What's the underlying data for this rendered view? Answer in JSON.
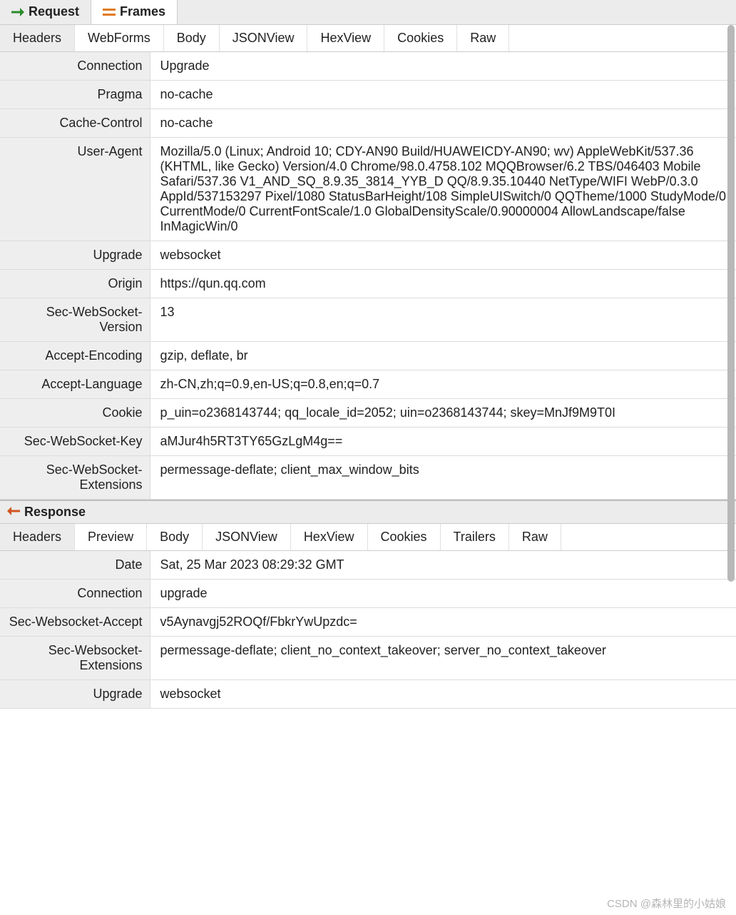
{
  "topTabs": {
    "request": "Request",
    "frames": "Frames"
  },
  "requestSubTabs": [
    "Headers",
    "WebForms",
    "Body",
    "JSONView",
    "HexView",
    "Cookies",
    "Raw"
  ],
  "requestHeaders": [
    {
      "key": "Connection",
      "value": "Upgrade"
    },
    {
      "key": "Pragma",
      "value": "no-cache"
    },
    {
      "key": "Cache-Control",
      "value": "no-cache"
    },
    {
      "key": "User-Agent",
      "value": "Mozilla/5.0 (Linux; Android 10; CDY-AN90 Build/HUAWEICDY-AN90; wv) AppleWebKit/537.36 (KHTML, like Gecko) Version/4.0 Chrome/98.0.4758.102 MQQBrowser/6.2 TBS/046403 Mobile Safari/537.36 V1_AND_SQ_8.9.35_3814_YYB_D QQ/8.9.35.10440 NetType/WIFI WebP/0.3.0 AppId/537153297 Pixel/1080 StatusBarHeight/108 SimpleUISwitch/0 QQTheme/1000 StudyMode/0 CurrentMode/0 CurrentFontScale/1.0 GlobalDensityScale/0.90000004 AllowLandscape/false InMagicWin/0"
    },
    {
      "key": "Upgrade",
      "value": "websocket"
    },
    {
      "key": "Origin",
      "value": "https://qun.qq.com"
    },
    {
      "key": "Sec-WebSocket-Version",
      "value": "13"
    },
    {
      "key": "Accept-Encoding",
      "value": "gzip, deflate, br"
    },
    {
      "key": "Accept-Language",
      "value": "zh-CN,zh;q=0.9,en-US;q=0.8,en;q=0.7"
    },
    {
      "key": "Cookie",
      "value": "p_uin=o2368143744; qq_locale_id=2052; uin=o2368143744; skey=MnJf9M9T0I"
    },
    {
      "key": "Sec-WebSocket-Key",
      "value": "aMJur4h5RT3TY65GzLgM4g=="
    },
    {
      "key": "Sec-WebSocket-Extensions",
      "value": "permessage-deflate; client_max_window_bits"
    }
  ],
  "responseTitle": "Response",
  "responseSubTabs": [
    "Headers",
    "Preview",
    "Body",
    "JSONView",
    "HexView",
    "Cookies",
    "Trailers",
    "Raw"
  ],
  "responseHeaders": [
    {
      "key": "Date",
      "value": "Sat, 25 Mar 2023 08:29:32 GMT"
    },
    {
      "key": "Connection",
      "value": "upgrade"
    },
    {
      "key": "Sec-Websocket-Accept",
      "value": "v5Aynavgj52ROQf/FbkrYwUpzdc="
    },
    {
      "key": "Sec-Websocket-Extensions",
      "value": "permessage-deflate; client_no_context_takeover; server_no_context_takeover"
    },
    {
      "key": "Upgrade",
      "value": "websocket"
    }
  ],
  "watermark": "CSDN @森林里的小姑娘"
}
